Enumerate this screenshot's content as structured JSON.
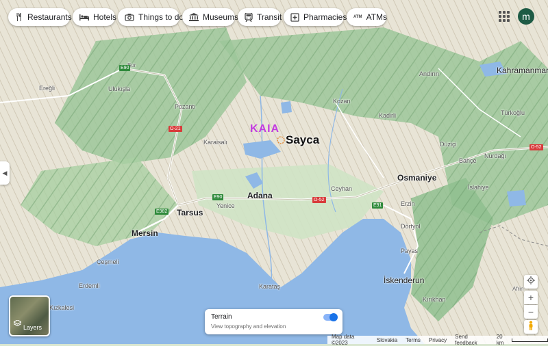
{
  "chips": [
    {
      "label": "Restaurants",
      "icon": "fork-knife-icon"
    },
    {
      "label": "Hotels",
      "icon": "bed-icon"
    },
    {
      "label": "Things to do",
      "icon": "camera-icon"
    },
    {
      "label": "Museums",
      "icon": "museum-icon"
    },
    {
      "label": "Transit",
      "icon": "train-icon"
    },
    {
      "label": "Pharmacies",
      "icon": "pharmacy-icon"
    },
    {
      "label": "ATMs",
      "icon": "atm-icon"
    }
  ],
  "atm_icon_text": "ATM",
  "avatar_letter": "m",
  "place_labels": {
    "bor": "Bor",
    "eregli": "Ereğli",
    "ulukisla": "Ulukışla",
    "pozanti": "Pozantı",
    "karaisali": "Karaisalı",
    "kozan": "Kozan",
    "kadirli": "Kadirli",
    "andirin": "Andırın",
    "kahramanmaras": "Kahramanmaraş",
    "turkoglu": "Türkoğlu",
    "duzici": "Düziçi",
    "bahce": "Bahçe",
    "nurdagi": "Nurdağı",
    "osmaniye": "Osmaniye",
    "islahiye": "İslahiye",
    "ceyhan": "Ceyhan",
    "adana": "Adana",
    "yenice": "Yenice",
    "tarsus": "Tarsus",
    "mersin": "Mersin",
    "erzin": "Erzin",
    "dortyol": "Dörtyol",
    "payas": "Payas",
    "iskenderun": "İskenderun",
    "kirikhan": "Kırıkhan",
    "cesmeli": "Çeşmeli",
    "erdemli": "Erdemli",
    "kizkalesi": "Kızkalesi",
    "karatas": "Karataş",
    "afrin": "Afrin"
  },
  "road_shields": {
    "e90a": "E90",
    "o21": "O-21",
    "e90b": "E90",
    "e982": "E982",
    "o52a": "O-52",
    "e91": "E91",
    "o52b": "O-52"
  },
  "overlay": {
    "kaia": "KAIA",
    "sayca": "Sayca"
  },
  "layers_label": "Layers",
  "terrain": {
    "title": "Terrain",
    "subtitle": "View topography and elevation",
    "enabled": true
  },
  "footer": {
    "map_data": "Map data ©2023",
    "region": "Slovakia",
    "terms": "Terms",
    "privacy": "Privacy",
    "feedback": "Send feedback",
    "scale": "20 km"
  },
  "colors": {
    "water": "#8fb8e6",
    "land": "#e8e4d6",
    "forest": "#8fbf8f",
    "accent": "#1a73e8",
    "kaia": "#c33ce0"
  }
}
